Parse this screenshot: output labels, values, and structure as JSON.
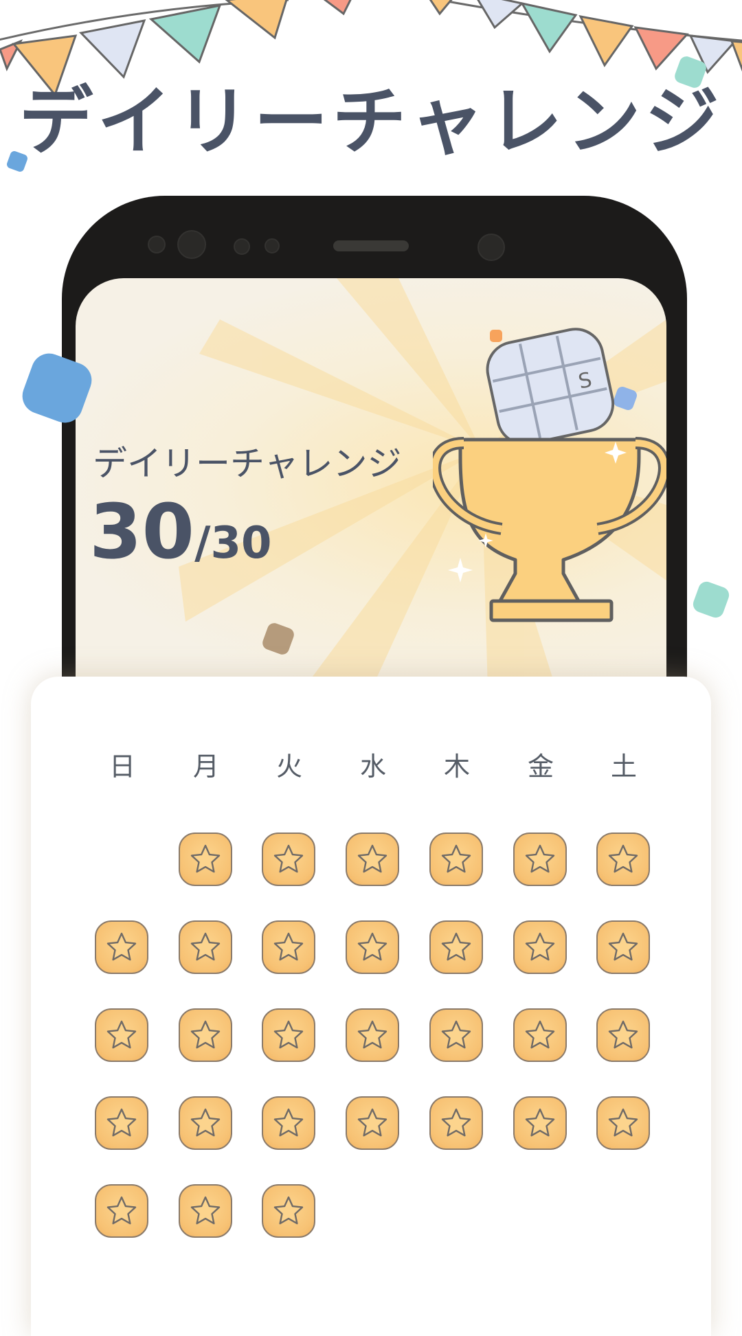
{
  "header": {
    "title": "デイリーチャレンジ"
  },
  "phone_screen": {
    "label": "デイリーチャレンジ",
    "score_value": "30",
    "score_total": "/30"
  },
  "calendar": {
    "weekdays": [
      "日",
      "月",
      "火",
      "水",
      "木",
      "金",
      "土"
    ],
    "leading_blank_days": 1,
    "completed_days": 30,
    "total_days": 30
  },
  "colors": {
    "title_text": "#4a5366",
    "stamp_fill": "#f7c274",
    "trophy_fill": "#fbd07f",
    "card_bg": "#ffffff"
  },
  "icons": [
    "bunting-flags",
    "trophy-icon",
    "puzzle-card-icon",
    "star-stamp-icon",
    "sparkle-icon"
  ]
}
